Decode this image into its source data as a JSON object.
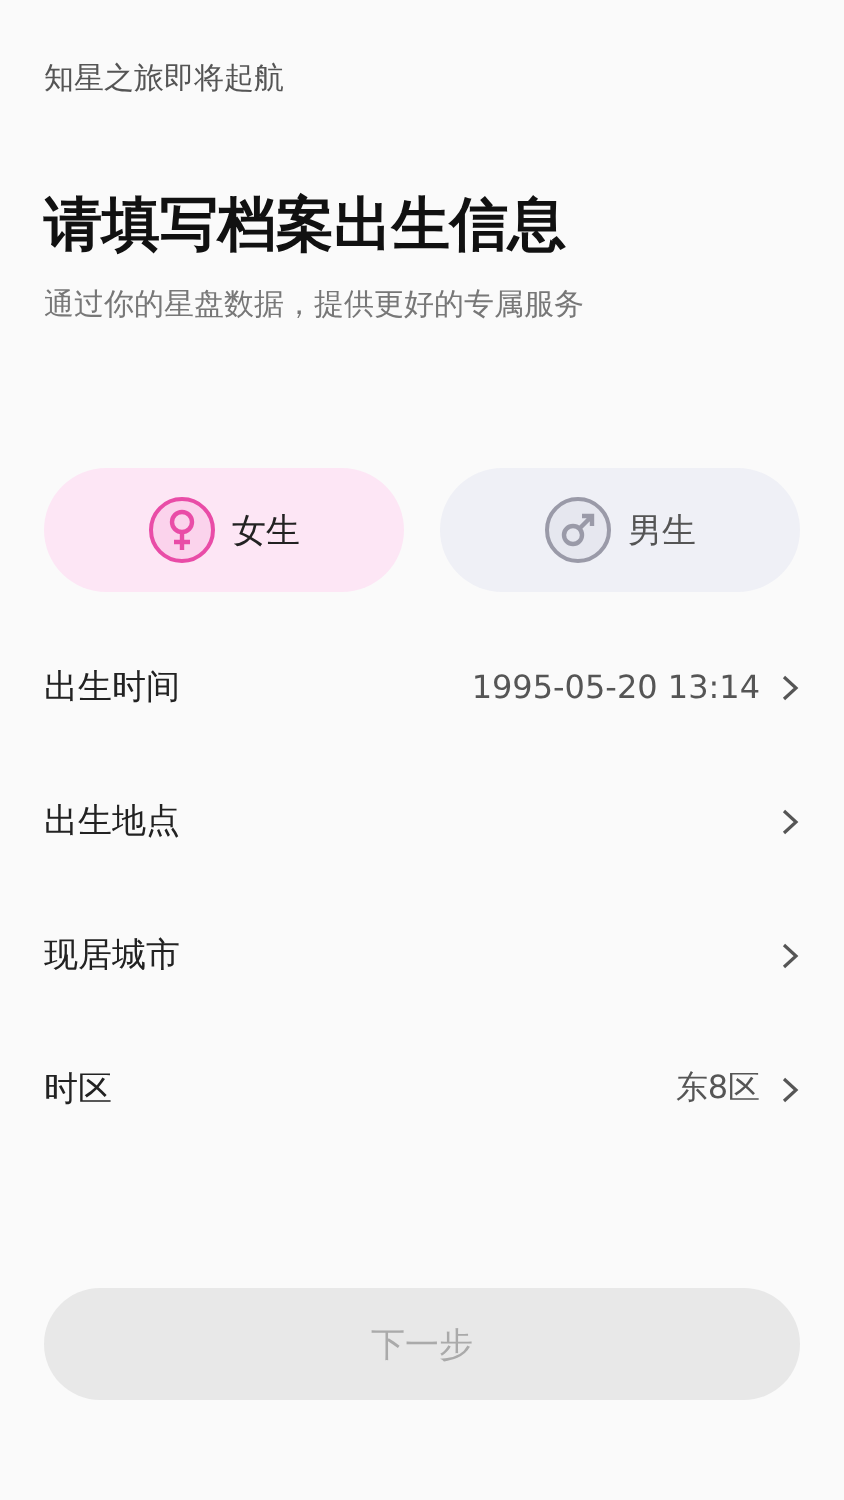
{
  "header": {
    "tagline": "知星之旅即将起航",
    "title": "请填写档案出生信息",
    "subtitle": "通过你的星盘数据，提供更好的专属服务"
  },
  "genders": [
    {
      "kind": "female",
      "label": "女生",
      "selected": true
    },
    {
      "kind": "male",
      "label": "男生",
      "selected": false
    }
  ],
  "fields": [
    {
      "label": "出生时间",
      "value": "1995-05-20 13:14"
    },
    {
      "label": "出生地点"
    },
    {
      "label": "现居城市"
    },
    {
      "label": "时区",
      "value": "东8区"
    }
  ],
  "next_button": {
    "label": "下一步",
    "disabled": true
  }
}
